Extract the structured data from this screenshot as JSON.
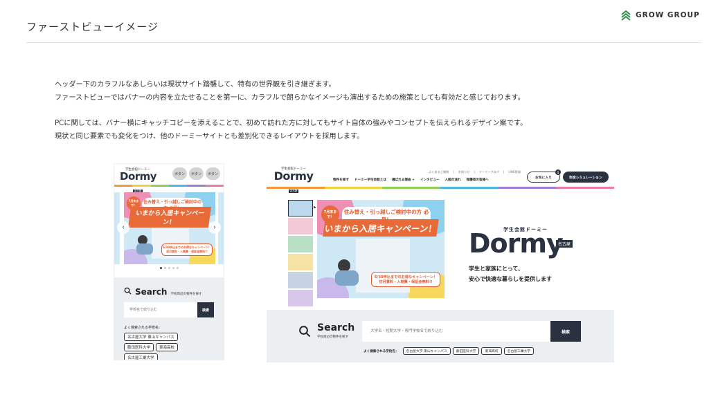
{
  "page": {
    "title": "ファーストビューイメージ",
    "brand": "GROW GROUP",
    "description": [
      "ヘッダー下のカラフルなあしらいは現状サイト踏襲して、特有の世界観を引き継ぎます。",
      "ファーストビューではバナーの内容を立たせることを第一に、カラフルで朗らかなイメージも演出するための施策としても有効だと感じております。",
      "PCに関しては、バナー横にキャッチコピーを添えることで、初めて訪れた方に対してもサイト自体の強みやコンセプトを伝えられるデザイン案です。",
      "現状と同じ要素でも変化をつけ、他のドーミーサイトとも差別化できるレイアウトを採用します。"
    ]
  },
  "colors": {
    "rainbow": [
      "#f29a3a",
      "#f4d03f",
      "#8fce5a",
      "#4fb7e6",
      "#9b7fd4",
      "#ef7aa0"
    ],
    "navy": "#2a3242",
    "accent": "#e86a38",
    "search_bg": "#eceff2"
  },
  "mobile": {
    "logo_sub": "学生会館ドーミー",
    "logo": "Dormy",
    "logo_badge": "名古屋",
    "buttons": [
      "ボタン",
      "ボタン",
      "ボタン"
    ],
    "banner": {
      "corner_badge": "7月末まで！",
      "head": "住み替え・引っ越しご検討中の方 必見！",
      "title": "いまから入居キャンペーン！",
      "note1": "6/30申込までのお得なキャンペーン！",
      "note2": "初月賃料・入館費・保証金無料!!"
    },
    "search_label": "Search",
    "search_sub": "学校周辺の物件を探す",
    "search_placeholder": "学校名で絞り込む",
    "search_button": "検索",
    "popular_label": "よく検索される学校名：",
    "schools": [
      "名古屋大学 東山キャンパス",
      "藤田医科大学",
      "東海高校",
      "名古屋工業大学"
    ]
  },
  "pc": {
    "logo_sub": "学生会館ドーミー",
    "logo": "Dormy",
    "logo_badge": "名古屋",
    "util_links": [
      "よくあるご質問",
      "お知らせ",
      "ドーミーブログ",
      "LINE登録"
    ],
    "nav": [
      "物件を探す",
      "ドーミー学生会館とは",
      "選ばれる理由 +",
      "インタビュー",
      "入館の流れ",
      "保護者の皆様へ"
    ],
    "favorites_label": "お気に入り",
    "favorites_count": "1",
    "simulation_label": "料金シミュレーション",
    "hero_sub": "学生会館ドーミー",
    "hero_logo": "Dormy",
    "hero_badge": "名古屋",
    "tagline1": "学生と家族にとって、",
    "tagline2": "安心で快適な暮らしを提供します",
    "search_label": "Search",
    "search_sub": "学校周辺の物件を探す",
    "search_placeholder": "大学名・短期大学・専門学校名で絞り込む",
    "search_button": "検索",
    "popular_label": "よく検索される学校名：",
    "schools": [
      "名古屋大学 東山キャンパス",
      "藤田医科大学",
      "東海高校",
      "名古屋工業大学"
    ]
  }
}
